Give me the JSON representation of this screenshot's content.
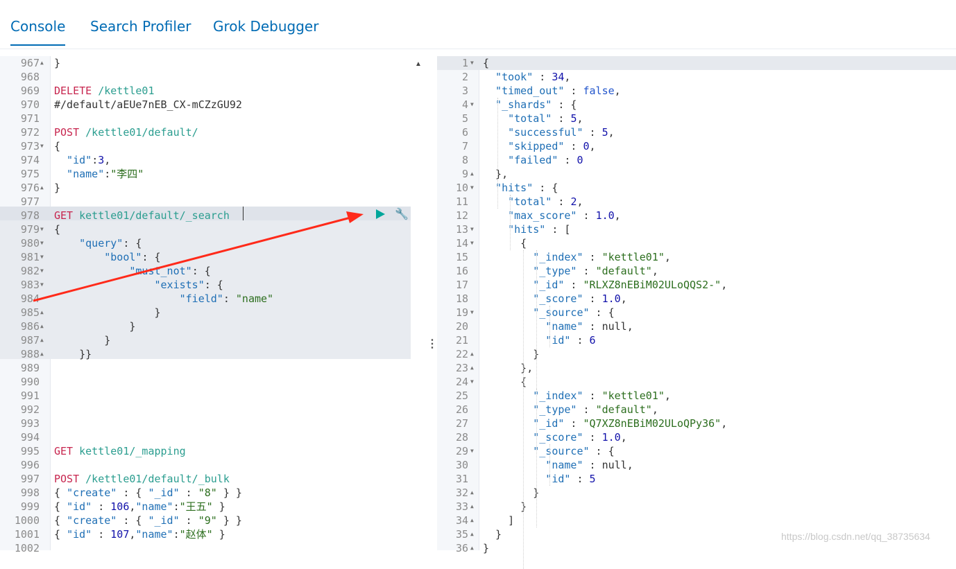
{
  "tabs": [
    "Console",
    "Search Profiler",
    "Grok Debugger"
  ],
  "actions": {
    "run_icon": "play-icon",
    "settings_icon": "wrench-icon"
  },
  "colors": {
    "accent": "#006bb4",
    "method": "#c7254e",
    "url": "#2a9d8f",
    "key": "#1f6fb5",
    "string": "#2c6e1e",
    "arrow": "#ff2a1a"
  },
  "request": {
    "lines": [
      {
        "n": "967",
        "f": "up",
        "t": [
          [
            "}",
            "p"
          ]
        ]
      },
      {
        "n": "968",
        "t": []
      },
      {
        "n": "969",
        "t": [
          [
            "DELETE ",
            "m"
          ],
          [
            "/kettle01",
            "u"
          ]
        ]
      },
      {
        "n": "970",
        "t": [
          [
            "#/default/aEUe7nEB_CX-mCZzGU92",
            "p"
          ]
        ]
      },
      {
        "n": "971",
        "t": []
      },
      {
        "n": "972",
        "t": [
          [
            "POST ",
            "m"
          ],
          [
            "/kettle01/default/",
            "u"
          ]
        ]
      },
      {
        "n": "973",
        "f": "down",
        "t": [
          [
            "{",
            "p"
          ]
        ]
      },
      {
        "n": "974",
        "t": [
          [
            "  \"id\"",
            "k"
          ],
          [
            ":",
            "p"
          ],
          [
            "3",
            "n"
          ],
          [
            ",",
            "p"
          ]
        ]
      },
      {
        "n": "975",
        "t": [
          [
            "  \"name\"",
            "k"
          ],
          [
            ":",
            "p"
          ],
          [
            "\"李四\"",
            "s"
          ]
        ]
      },
      {
        "n": "976",
        "f": "up",
        "t": [
          [
            "}",
            "p"
          ]
        ]
      },
      {
        "n": "977",
        "t": []
      },
      {
        "n": "978",
        "t": [
          [
            "GET ",
            "m"
          ],
          [
            "kettle01/default/_search",
            "u"
          ]
        ]
      },
      {
        "n": "979",
        "f": "down",
        "t": [
          [
            "{",
            "p"
          ]
        ]
      },
      {
        "n": "980",
        "f": "down",
        "t": [
          [
            "    \"query\"",
            "k"
          ],
          [
            ": {",
            "p"
          ]
        ]
      },
      {
        "n": "981",
        "f": "down",
        "t": [
          [
            "        \"bool\"",
            "k"
          ],
          [
            ": {",
            "p"
          ]
        ]
      },
      {
        "n": "982",
        "f": "down",
        "t": [
          [
            "            \"must_not\"",
            "k"
          ],
          [
            ": {",
            "p"
          ]
        ]
      },
      {
        "n": "983",
        "f": "down",
        "t": [
          [
            "                \"exists\"",
            "k"
          ],
          [
            ": {",
            "p"
          ]
        ]
      },
      {
        "n": "984",
        "t": [
          [
            "                    \"field\"",
            "k"
          ],
          [
            ": ",
            "p"
          ],
          [
            "\"name\"",
            "s"
          ]
        ]
      },
      {
        "n": "985",
        "f": "up",
        "t": [
          [
            "                }",
            "p"
          ]
        ]
      },
      {
        "n": "986",
        "f": "up",
        "t": [
          [
            "            }",
            "p"
          ]
        ]
      },
      {
        "n": "987",
        "f": "up",
        "t": [
          [
            "        }",
            "p"
          ]
        ]
      },
      {
        "n": "988",
        "f": "up",
        "t": [
          [
            "    }}",
            "p"
          ]
        ]
      },
      {
        "n": "989",
        "t": []
      },
      {
        "n": "990",
        "t": []
      },
      {
        "n": "991",
        "t": []
      },
      {
        "n": "992",
        "t": []
      },
      {
        "n": "993",
        "t": []
      },
      {
        "n": "994",
        "t": []
      },
      {
        "n": "995",
        "t": [
          [
            "GET ",
            "m"
          ],
          [
            "kettle01/_mapping",
            "u"
          ]
        ]
      },
      {
        "n": "996",
        "t": []
      },
      {
        "n": "997",
        "t": [
          [
            "POST ",
            "m"
          ],
          [
            "/kettle01/default/_bulk",
            "u"
          ]
        ]
      },
      {
        "n": "998",
        "t": [
          [
            "{ ",
            "p"
          ],
          [
            "\"create\"",
            "k"
          ],
          [
            " : { ",
            "p"
          ],
          [
            "\"_id\"",
            "k"
          ],
          [
            " : ",
            "p"
          ],
          [
            "\"8\"",
            "s"
          ],
          [
            " } }",
            "p"
          ]
        ]
      },
      {
        "n": "999",
        "t": [
          [
            "{ ",
            "p"
          ],
          [
            "\"id\"",
            "k"
          ],
          [
            " : ",
            "p"
          ],
          [
            "106",
            "n"
          ],
          [
            ",",
            "p"
          ],
          [
            "\"name\"",
            "k"
          ],
          [
            ":",
            "p"
          ],
          [
            "\"王五\"",
            "s"
          ],
          [
            " }",
            "p"
          ]
        ]
      },
      {
        "n": "1000",
        "t": [
          [
            "{ ",
            "p"
          ],
          [
            "\"create\"",
            "k"
          ],
          [
            " : { ",
            "p"
          ],
          [
            "\"_id\"",
            "k"
          ],
          [
            " : ",
            "p"
          ],
          [
            "\"9\"",
            "s"
          ],
          [
            " } }",
            "p"
          ]
        ]
      },
      {
        "n": "1001",
        "t": [
          [
            "{ ",
            "p"
          ],
          [
            "\"id\"",
            "k"
          ],
          [
            " : ",
            "p"
          ],
          [
            "107",
            "n"
          ],
          [
            ",",
            "p"
          ],
          [
            "\"name\"",
            "k"
          ],
          [
            ":",
            "p"
          ],
          [
            "\"赵体\"",
            "s"
          ],
          [
            " }",
            "p"
          ]
        ]
      },
      {
        "n": "1002",
        "t": []
      }
    ]
  },
  "response": {
    "lines": [
      {
        "n": "1",
        "f": "down",
        "t": [
          [
            "{",
            "p"
          ]
        ]
      },
      {
        "n": "2",
        "t": [
          [
            "  \"took\"",
            "k"
          ],
          [
            " : ",
            "p"
          ],
          [
            "34",
            "n"
          ],
          [
            ",",
            "p"
          ]
        ]
      },
      {
        "n": "3",
        "t": [
          [
            "  \"timed_out\"",
            "k"
          ],
          [
            " : ",
            "p"
          ],
          [
            "false",
            "b"
          ],
          [
            ",",
            "p"
          ]
        ]
      },
      {
        "n": "4",
        "f": "down",
        "t": [
          [
            "  \"_shards\"",
            "k"
          ],
          [
            " : {",
            "p"
          ]
        ]
      },
      {
        "n": "5",
        "t": [
          [
            "    \"total\"",
            "k"
          ],
          [
            " : ",
            "p"
          ],
          [
            "5",
            "n"
          ],
          [
            ",",
            "p"
          ]
        ]
      },
      {
        "n": "6",
        "t": [
          [
            "    \"successful\"",
            "k"
          ],
          [
            " : ",
            "p"
          ],
          [
            "5",
            "n"
          ],
          [
            ",",
            "p"
          ]
        ]
      },
      {
        "n": "7",
        "t": [
          [
            "    \"skipped\"",
            "k"
          ],
          [
            " : ",
            "p"
          ],
          [
            "0",
            "n"
          ],
          [
            ",",
            "p"
          ]
        ]
      },
      {
        "n": "8",
        "t": [
          [
            "    \"failed\"",
            "k"
          ],
          [
            " : ",
            "p"
          ],
          [
            "0",
            "n"
          ]
        ]
      },
      {
        "n": "9",
        "f": "up",
        "t": [
          [
            "  },",
            "p"
          ]
        ]
      },
      {
        "n": "10",
        "f": "down",
        "t": [
          [
            "  \"hits\"",
            "k"
          ],
          [
            " : {",
            "p"
          ]
        ]
      },
      {
        "n": "11",
        "t": [
          [
            "    \"total\"",
            "k"
          ],
          [
            " : ",
            "p"
          ],
          [
            "2",
            "n"
          ],
          [
            ",",
            "p"
          ]
        ]
      },
      {
        "n": "12",
        "t": [
          [
            "    \"max_score\"",
            "k"
          ],
          [
            " : ",
            "p"
          ],
          [
            "1.0",
            "n"
          ],
          [
            ",",
            "p"
          ]
        ]
      },
      {
        "n": "13",
        "f": "down",
        "t": [
          [
            "    \"hits\"",
            "k"
          ],
          [
            " : [",
            "p"
          ]
        ]
      },
      {
        "n": "14",
        "f": "down",
        "t": [
          [
            "      {",
            "p"
          ]
        ]
      },
      {
        "n": "15",
        "t": [
          [
            "        \"_index\"",
            "k"
          ],
          [
            " : ",
            "p"
          ],
          [
            "\"kettle01\"",
            "s"
          ],
          [
            ",",
            "p"
          ]
        ]
      },
      {
        "n": "16",
        "t": [
          [
            "        \"_type\"",
            "k"
          ],
          [
            " : ",
            "p"
          ],
          [
            "\"default\"",
            "s"
          ],
          [
            ",",
            "p"
          ]
        ]
      },
      {
        "n": "17",
        "t": [
          [
            "        \"_id\"",
            "k"
          ],
          [
            " : ",
            "p"
          ],
          [
            "\"RLXZ8nEBiM02ULoQQS2-\"",
            "s"
          ],
          [
            ",",
            "p"
          ]
        ]
      },
      {
        "n": "18",
        "t": [
          [
            "        \"_score\"",
            "k"
          ],
          [
            " : ",
            "p"
          ],
          [
            "1.0",
            "n"
          ],
          [
            ",",
            "p"
          ]
        ]
      },
      {
        "n": "19",
        "f": "down",
        "t": [
          [
            "        \"_source\"",
            "k"
          ],
          [
            " : {",
            "p"
          ]
        ]
      },
      {
        "n": "20",
        "t": [
          [
            "          \"name\"",
            "k"
          ],
          [
            " : ",
            "p"
          ],
          [
            "null",
            "p"
          ],
          [
            ",",
            "p"
          ]
        ]
      },
      {
        "n": "21",
        "t": [
          [
            "          \"id\"",
            "k"
          ],
          [
            " : ",
            "p"
          ],
          [
            "6",
            "n"
          ]
        ]
      },
      {
        "n": "22",
        "f": "up",
        "t": [
          [
            "        }",
            "p"
          ]
        ]
      },
      {
        "n": "23",
        "f": "up",
        "t": [
          [
            "      },",
            "p"
          ]
        ]
      },
      {
        "n": "24",
        "f": "down",
        "t": [
          [
            "      {",
            "p"
          ]
        ]
      },
      {
        "n": "25",
        "t": [
          [
            "        \"_index\"",
            "k"
          ],
          [
            " : ",
            "p"
          ],
          [
            "\"kettle01\"",
            "s"
          ],
          [
            ",",
            "p"
          ]
        ]
      },
      {
        "n": "26",
        "t": [
          [
            "        \"_type\"",
            "k"
          ],
          [
            " : ",
            "p"
          ],
          [
            "\"default\"",
            "s"
          ],
          [
            ",",
            "p"
          ]
        ]
      },
      {
        "n": "27",
        "t": [
          [
            "        \"_id\"",
            "k"
          ],
          [
            " : ",
            "p"
          ],
          [
            "\"Q7XZ8nEBiM02ULoQPy36\"",
            "s"
          ],
          [
            ",",
            "p"
          ]
        ]
      },
      {
        "n": "28",
        "t": [
          [
            "        \"_score\"",
            "k"
          ],
          [
            " : ",
            "p"
          ],
          [
            "1.0",
            "n"
          ],
          [
            ",",
            "p"
          ]
        ]
      },
      {
        "n": "29",
        "f": "down",
        "t": [
          [
            "        \"_source\"",
            "k"
          ],
          [
            " : {",
            "p"
          ]
        ]
      },
      {
        "n": "30",
        "t": [
          [
            "          \"name\"",
            "k"
          ],
          [
            " : ",
            "p"
          ],
          [
            "null",
            "p"
          ],
          [
            ",",
            "p"
          ]
        ]
      },
      {
        "n": "31",
        "t": [
          [
            "          \"id\"",
            "k"
          ],
          [
            " : ",
            "p"
          ],
          [
            "5",
            "n"
          ]
        ]
      },
      {
        "n": "32",
        "f": "up",
        "t": [
          [
            "        }",
            "p"
          ]
        ]
      },
      {
        "n": "33",
        "f": "up",
        "t": [
          [
            "      }",
            "p"
          ]
        ]
      },
      {
        "n": "34",
        "f": "up",
        "t": [
          [
            "    ]",
            "p"
          ]
        ]
      },
      {
        "n": "35",
        "f": "up",
        "t": [
          [
            "  }",
            "p"
          ]
        ]
      },
      {
        "n": "36",
        "f": "up",
        "t": [
          [
            "}",
            "p"
          ]
        ]
      }
    ]
  },
  "watermark": "https://blog.csdn.net/qq_38735634"
}
